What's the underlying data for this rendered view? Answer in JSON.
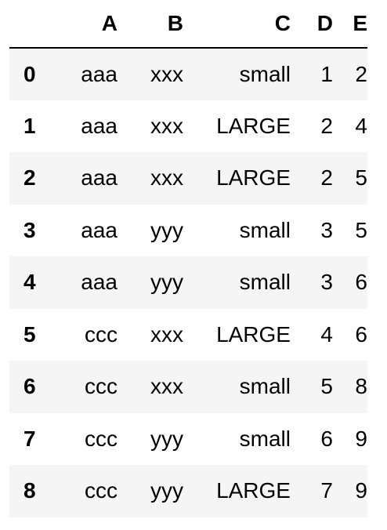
{
  "table": {
    "columns": [
      "",
      "A",
      "B",
      "C",
      "D",
      "E"
    ],
    "rows": [
      {
        "index": "0",
        "A": "aaa",
        "B": "xxx",
        "C": "small",
        "D": "1",
        "E": "2"
      },
      {
        "index": "1",
        "A": "aaa",
        "B": "xxx",
        "C": "LARGE",
        "D": "2",
        "E": "4"
      },
      {
        "index": "2",
        "A": "aaa",
        "B": "xxx",
        "C": "LARGE",
        "D": "2",
        "E": "5"
      },
      {
        "index": "3",
        "A": "aaa",
        "B": "yyy",
        "C": "small",
        "D": "3",
        "E": "5"
      },
      {
        "index": "4",
        "A": "aaa",
        "B": "yyy",
        "C": "small",
        "D": "3",
        "E": "6"
      },
      {
        "index": "5",
        "A": "ccc",
        "B": "xxx",
        "C": "LARGE",
        "D": "4",
        "E": "6"
      },
      {
        "index": "6",
        "A": "ccc",
        "B": "xxx",
        "C": "small",
        "D": "5",
        "E": "8"
      },
      {
        "index": "7",
        "A": "ccc",
        "B": "yyy",
        "C": "small",
        "D": "6",
        "E": "9"
      },
      {
        "index": "8",
        "A": "ccc",
        "B": "yyy",
        "C": "LARGE",
        "D": "7",
        "E": "9"
      }
    ]
  },
  "colors": {
    "stripe": "#f5f5f5",
    "header_rule": "#000000",
    "text": "#000000"
  }
}
